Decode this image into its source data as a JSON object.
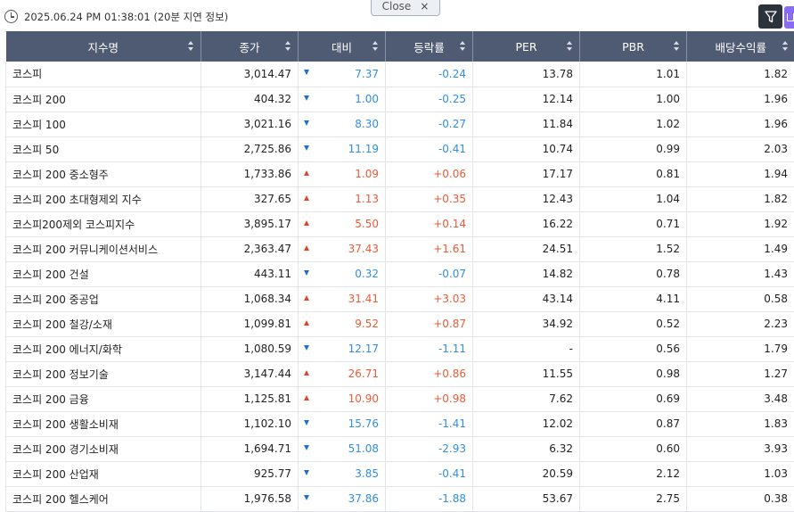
{
  "header": {
    "timestamp": "2025.06.24 PM 01:38:01",
    "delay_note": "(20분 지연 정보)",
    "close_label": "Close",
    "close_x": "×"
  },
  "table": {
    "columns": [
      "지수명",
      "종가",
      "대비",
      "등락률",
      "PER",
      "PBR",
      "배당수익률"
    ],
    "rows": [
      {
        "name": "코스피",
        "close": "3,014.47",
        "dir": "down",
        "change": "7.37",
        "rate": "-0.24",
        "per": "13.78",
        "pbr": "1.01",
        "div": "1.82"
      },
      {
        "name": "코스피 200",
        "close": "404.32",
        "dir": "down",
        "change": "1.00",
        "rate": "-0.25",
        "per": "12.14",
        "pbr": "1.00",
        "div": "1.96"
      },
      {
        "name": "코스피 100",
        "close": "3,021.16",
        "dir": "down",
        "change": "8.30",
        "rate": "-0.27",
        "per": "11.84",
        "pbr": "1.02",
        "div": "1.96"
      },
      {
        "name": "코스피 50",
        "close": "2,725.86",
        "dir": "down",
        "change": "11.19",
        "rate": "-0.41",
        "per": "10.74",
        "pbr": "0.99",
        "div": "2.03"
      },
      {
        "name": "코스피 200 중소형주",
        "close": "1,733.86",
        "dir": "up",
        "change": "1.09",
        "rate": "+0.06",
        "per": "17.17",
        "pbr": "0.81",
        "div": "1.94"
      },
      {
        "name": "코스피 200 초대형제외 지수",
        "close": "327.65",
        "dir": "up",
        "change": "1.13",
        "rate": "+0.35",
        "per": "12.43",
        "pbr": "1.04",
        "div": "1.82"
      },
      {
        "name": "코스피200제외 코스피지수",
        "close": "3,895.17",
        "dir": "up",
        "change": "5.50",
        "rate": "+0.14",
        "per": "16.22",
        "pbr": "0.71",
        "div": "1.92"
      },
      {
        "name": "코스피 200 커뮤니케이션서비스",
        "close": "2,363.47",
        "dir": "up",
        "change": "37.43",
        "rate": "+1.61",
        "per": "24.51",
        "pbr": "1.52",
        "div": "1.49"
      },
      {
        "name": "코스피 200 건설",
        "close": "443.11",
        "dir": "down",
        "change": "0.32",
        "rate": "-0.07",
        "per": "14.82",
        "pbr": "0.78",
        "div": "1.43"
      },
      {
        "name": "코스피 200 중공업",
        "close": "1,068.34",
        "dir": "up",
        "change": "31.41",
        "rate": "+3.03",
        "per": "43.14",
        "pbr": "4.11",
        "div": "0.58"
      },
      {
        "name": "코스피 200 철강/소재",
        "close": "1,099.81",
        "dir": "up",
        "change": "9.52",
        "rate": "+0.87",
        "per": "34.92",
        "pbr": "0.52",
        "div": "2.23"
      },
      {
        "name": "코스피 200 에너지/화학",
        "close": "1,080.59",
        "dir": "down",
        "change": "12.17",
        "rate": "-1.11",
        "per": "-",
        "pbr": "0.56",
        "div": "1.79"
      },
      {
        "name": "코스피 200 정보기술",
        "close": "3,147.44",
        "dir": "up",
        "change": "26.71",
        "rate": "+0.86",
        "per": "11.55",
        "pbr": "0.98",
        "div": "1.27"
      },
      {
        "name": "코스피 200 금융",
        "close": "1,125.81",
        "dir": "up",
        "change": "10.90",
        "rate": "+0.98",
        "per": "7.62",
        "pbr": "0.69",
        "div": "3.48"
      },
      {
        "name": "코스피 200 생활소비재",
        "close": "1,102.10",
        "dir": "down",
        "change": "15.76",
        "rate": "-1.41",
        "per": "12.02",
        "pbr": "0.87",
        "div": "1.83"
      },
      {
        "name": "코스피 200 경기소비재",
        "close": "1,694.71",
        "dir": "down",
        "change": "51.08",
        "rate": "-2.93",
        "per": "6.32",
        "pbr": "0.60",
        "div": "3.93"
      },
      {
        "name": "코스피 200 산업재",
        "close": "925.77",
        "dir": "down",
        "change": "3.85",
        "rate": "-0.41",
        "per": "20.59",
        "pbr": "2.12",
        "div": "1.03"
      },
      {
        "name": "코스피 200 헬스케어",
        "close": "1,976.58",
        "dir": "down",
        "change": "37.86",
        "rate": "-1.88",
        "per": "53.67",
        "pbr": "2.75",
        "div": "0.38"
      }
    ]
  },
  "colors": {
    "header_bg": "#4f5a73",
    "up": "#ee5a35",
    "down": "#2f8ee6",
    "filter_btn": "#2d333d",
    "purple_btn": "#8a6cf2"
  },
  "icons": [
    "clock-icon",
    "close-icon",
    "filter-icon",
    "export-icon",
    "sort-icon",
    "up-arrow-icon",
    "down-arrow-icon"
  ]
}
